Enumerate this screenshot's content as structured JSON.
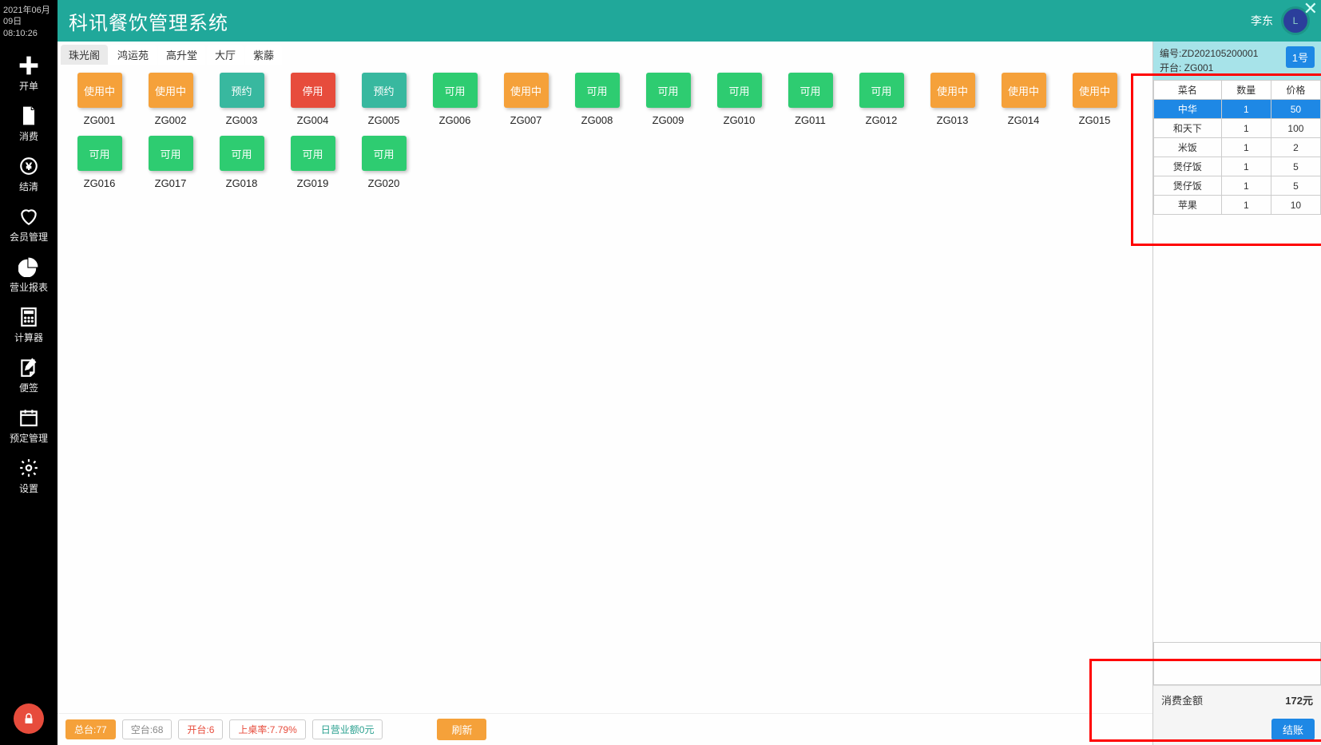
{
  "clock": {
    "date": "2021年06月09日",
    "time": "08:10:26"
  },
  "header": {
    "title": "科讯餐饮管理系统",
    "user": "李东",
    "avatar_initial": "L"
  },
  "sidebar": {
    "items": [
      {
        "label": "开单"
      },
      {
        "label": "消费"
      },
      {
        "label": "结清"
      },
      {
        "label": "会员管理"
      },
      {
        "label": "营业报表"
      },
      {
        "label": "计算器"
      },
      {
        "label": "便签"
      },
      {
        "label": "预定管理"
      },
      {
        "label": "设置"
      }
    ]
  },
  "tabs": [
    "珠光阁",
    "鸿运苑",
    "高升堂",
    "大厅",
    "紫藤"
  ],
  "active_tab_index": 0,
  "status_text": {
    "inuse": "使用中",
    "reserve": "预约",
    "stop": "停用",
    "free": "可用"
  },
  "tables": [
    {
      "id": "ZG001",
      "status": "inuse"
    },
    {
      "id": "ZG002",
      "status": "inuse"
    },
    {
      "id": "ZG003",
      "status": "reserve"
    },
    {
      "id": "ZG004",
      "status": "stop"
    },
    {
      "id": "ZG005",
      "status": "reserve"
    },
    {
      "id": "ZG006",
      "status": "free"
    },
    {
      "id": "ZG007",
      "status": "inuse"
    },
    {
      "id": "ZG008",
      "status": "free"
    },
    {
      "id": "ZG009",
      "status": "free"
    },
    {
      "id": "ZG010",
      "status": "free"
    },
    {
      "id": "ZG011",
      "status": "free"
    },
    {
      "id": "ZG012",
      "status": "free"
    },
    {
      "id": "ZG013",
      "status": "inuse"
    },
    {
      "id": "ZG014",
      "status": "inuse"
    },
    {
      "id": "ZG015",
      "status": "inuse"
    },
    {
      "id": "ZG016",
      "status": "free"
    },
    {
      "id": "ZG017",
      "status": "free"
    },
    {
      "id": "ZG018",
      "status": "free"
    },
    {
      "id": "ZG019",
      "status": "free"
    },
    {
      "id": "ZG020",
      "status": "free"
    }
  ],
  "footer": {
    "total": "总台:77",
    "empty": "空台:68",
    "open": "开台:6",
    "rate": "上桌率:7.79%",
    "revenue": "日营业额0元",
    "refresh": "刷新"
  },
  "order": {
    "id_label": "编号:ZD202105200001",
    "table_label": "开台: ZG001",
    "badge": "1号",
    "columns": [
      "菜名",
      "数量",
      "价格"
    ],
    "rows": [
      {
        "name": "中华",
        "qty": "1",
        "price": "50",
        "selected": true
      },
      {
        "name": "和天下",
        "qty": "1",
        "price": "100",
        "selected": false
      },
      {
        "name": "米饭",
        "qty": "1",
        "price": "2",
        "selected": false
      },
      {
        "name": "煲仔饭",
        "qty": "1",
        "price": "5",
        "selected": false
      },
      {
        "name": "煲仔饭",
        "qty": "1",
        "price": "5",
        "selected": false
      },
      {
        "name": "苹果",
        "qty": "1",
        "price": "10",
        "selected": false
      }
    ],
    "total_label": "消费金额",
    "total_value": "172元",
    "checkout": "结账"
  }
}
